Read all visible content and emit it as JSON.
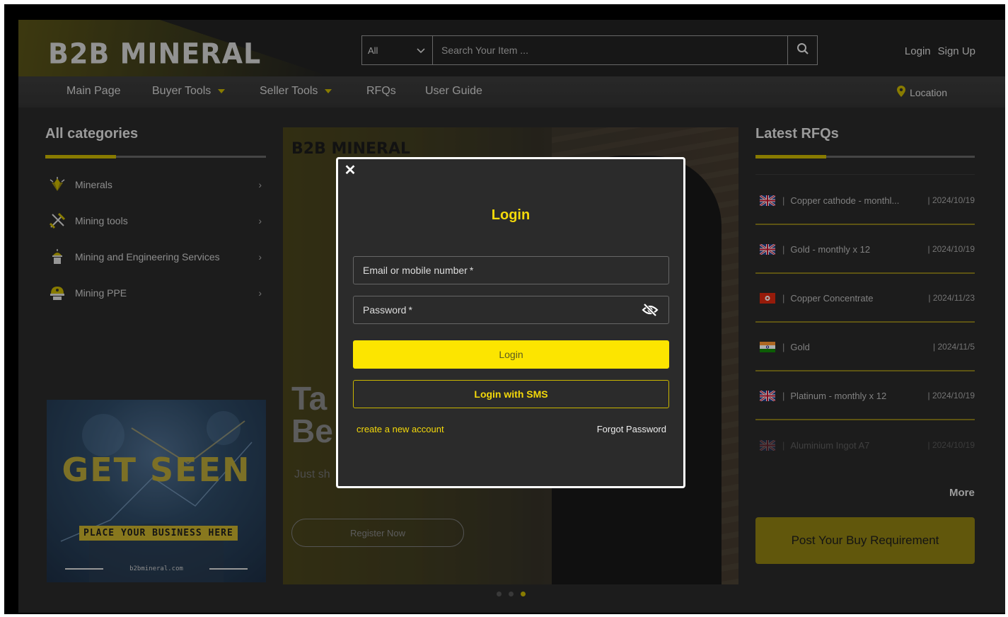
{
  "header": {
    "logo": "B2B MINERAL",
    "search": {
      "category": "All",
      "placeholder": "Search Your Item ..."
    },
    "auth": {
      "login": "Login",
      "signup": "Sign Up"
    }
  },
  "nav": {
    "items": [
      {
        "label": "Main Page"
      },
      {
        "label": "Buyer Tools"
      },
      {
        "label": "Seller Tools"
      },
      {
        "label": "RFQs"
      },
      {
        "label": "User Guide"
      }
    ],
    "location": "Location"
  },
  "categories": {
    "title": "All categories",
    "items": [
      {
        "label": "Minerals",
        "icon": "minerals-icon"
      },
      {
        "label": "Mining tools",
        "icon": "mining-tools-icon"
      },
      {
        "label": "Mining and Engineering Services",
        "icon": "services-icon"
      },
      {
        "label": "Mining PPE",
        "icon": "ppe-icon"
      }
    ]
  },
  "ad": {
    "title": "GET SEEN",
    "cta": "PLACE YOUR BUSINESS HERE",
    "url": "b2bmineral.com"
  },
  "hero": {
    "logo": "B2B MINERAL",
    "headline_line1": "Ta",
    "headline_line2": "Be",
    "subtext": "Just sh",
    "register": "Register Now"
  },
  "rfqs": {
    "title": "Latest RFQs",
    "items": [
      {
        "flag": "uk",
        "title": "Copper cathode - monthl...",
        "date": "2024/10/19"
      },
      {
        "flag": "uk",
        "title": "Gold - monthly x 12",
        "date": "2024/10/19"
      },
      {
        "flag": "hk",
        "title": "Copper Concentrate",
        "date": "2024/11/23"
      },
      {
        "flag": "in",
        "title": "Gold",
        "date": "2024/11/5"
      },
      {
        "flag": "uk",
        "title": "Platinum - monthly x 12",
        "date": "2024/10/19"
      },
      {
        "flag": "uk",
        "title": "Aluminium Ingot A7",
        "date": "2024/10/19"
      }
    ],
    "more": "More",
    "post_button": "Post Your Buy Requirement"
  },
  "modal": {
    "title": "Login",
    "email_label": "Email or mobile number",
    "password_label": "Password",
    "required_mark": "*",
    "login_button": "Login",
    "sms_button": "Login with SMS",
    "create_account": "create a new account",
    "forgot_password": "Forgot Password"
  },
  "colors": {
    "accent": "#f4d90a",
    "page_bg": "#2a2a2a",
    "button_yellow": "#fce500"
  }
}
